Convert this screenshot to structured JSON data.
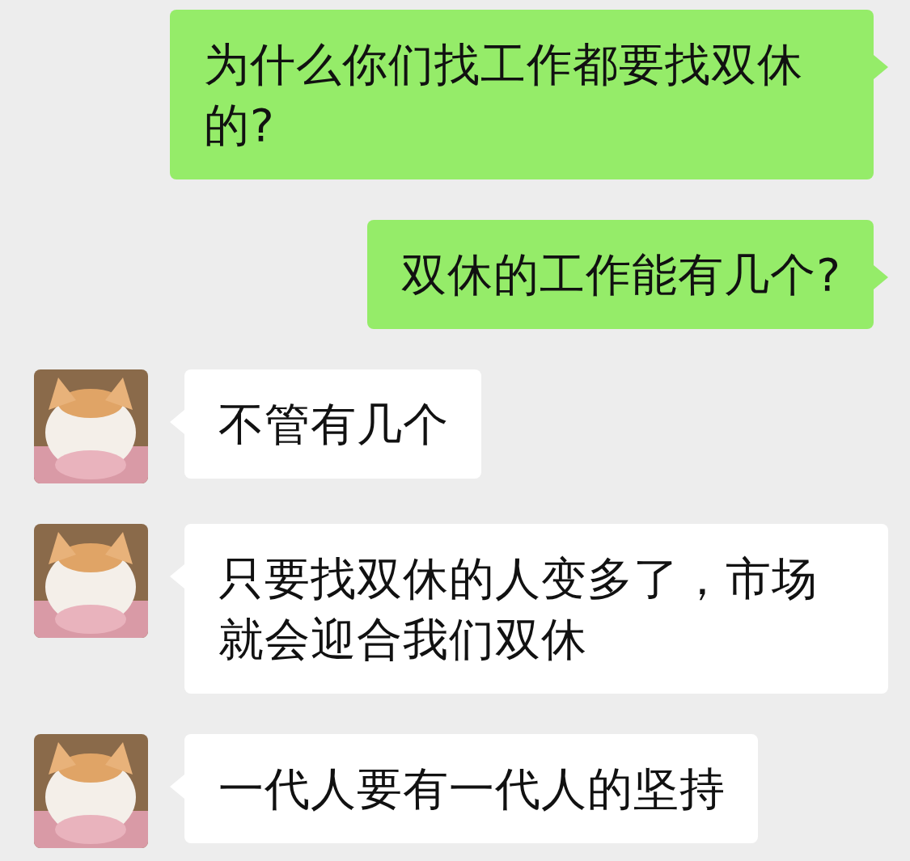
{
  "messages": [
    {
      "kind": "outgoing",
      "text": "为什么你们找工作都要找双休的?"
    },
    {
      "kind": "outgoing",
      "text": "双休的工作能有几个?"
    },
    {
      "kind": "incoming",
      "text": "不管有几个"
    },
    {
      "kind": "incoming",
      "text": "只要找双休的人变多了，市场就会迎合我们双休"
    },
    {
      "kind": "incoming",
      "text": "一代人要有一代人的坚持"
    }
  ]
}
